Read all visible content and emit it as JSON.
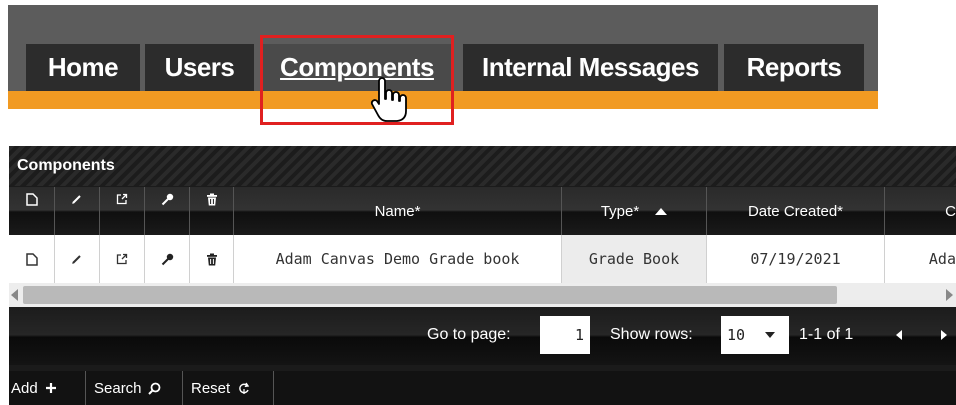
{
  "nav": {
    "tabs": [
      {
        "label": "Home"
      },
      {
        "label": "Users"
      },
      {
        "label": "Components"
      },
      {
        "label": "Internal Messages"
      },
      {
        "label": "Reports"
      }
    ],
    "active_tab": "Components"
  },
  "grid": {
    "title": "Components",
    "columns": [
      "Name*",
      "Type*",
      "Date Created*",
      "C"
    ],
    "row": {
      "name": "Adam Canvas Demo Grade book",
      "type": "Grade Book",
      "date_created": "07/19/2021",
      "created_by": "Ada"
    },
    "pager": {
      "goto_label": "Go to page:",
      "page_value": "1",
      "show_rows_label": "Show rows:",
      "rows_value": "10",
      "range_text": "1-1 of 1"
    },
    "toolbar": {
      "add_label": "Add",
      "search_label": "Search",
      "reset_label": "Reset"
    }
  },
  "colors": {
    "accent_orange": "#f19a22",
    "nav_bg": "#5c5c5c",
    "highlight": "#e02020"
  }
}
